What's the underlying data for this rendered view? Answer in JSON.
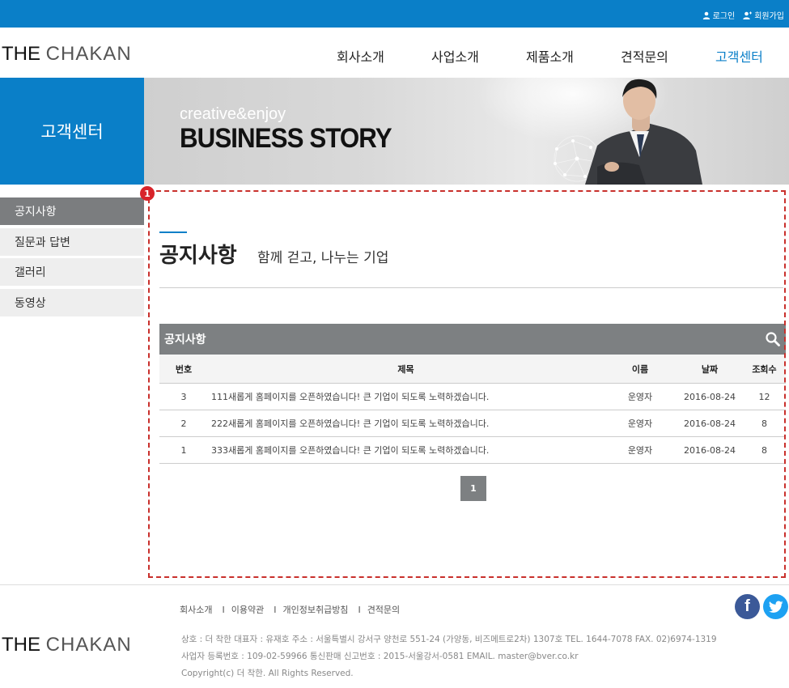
{
  "colors": {
    "brand": "#0a7fc8",
    "gray_bar": "#7d8082",
    "dash": "#c9302c",
    "marker": "#d8232a"
  },
  "top": {
    "login": "로그인",
    "join": "회원가입"
  },
  "logo": {
    "part1": "THE",
    "part2": "CHAKAN"
  },
  "nav": [
    {
      "label": "회사소개"
    },
    {
      "label": "사업소개"
    },
    {
      "label": "제품소개"
    },
    {
      "label": "견적문의"
    },
    {
      "label": "고객센터"
    }
  ],
  "section_title": "고객센터",
  "banner": {
    "sub": "creative&enjoy",
    "main": "BUSINESS STORY"
  },
  "sidebar": [
    {
      "label": "공지사항"
    },
    {
      "label": "질문과 답변"
    },
    {
      "label": "갤러리"
    },
    {
      "label": "동영상"
    }
  ],
  "marker": "1",
  "content": {
    "title": "공지사항",
    "subtitle": "함께 걷고, 나누는 기업"
  },
  "board": {
    "title": "공지사항",
    "headers": {
      "no": "번호",
      "title": "제목",
      "name": "이름",
      "date": "날짜",
      "views": "조회수"
    },
    "rows": [
      {
        "no": "3",
        "title": "111새롭게 홈페이지를 오픈하였습니다! 큰 기업이 되도록 노력하겠습니다.",
        "name": "운영자",
        "date": "2016-08-24",
        "views": "12"
      },
      {
        "no": "2",
        "title": "222새롭게 홈페이지를 오픈하였습니다! 큰 기업이 되도록 노력하겠습니다.",
        "name": "운영자",
        "date": "2016-08-24",
        "views": "8"
      },
      {
        "no": "1",
        "title": "333새롭게 홈페이지를 오픈하였습니다! 큰 기업이 되도록 노력하겠습니다.",
        "name": "운영자",
        "date": "2016-08-24",
        "views": "8"
      }
    ],
    "page": "1"
  },
  "footer": {
    "links": [
      {
        "label": "회사소개"
      },
      {
        "label": "이용약관"
      },
      {
        "label": "개인정보취급방침"
      },
      {
        "label": "견적문의"
      }
    ],
    "separator": "I",
    "info1": "상호 : 더 착한  대표자 : 유재호   주소 : 서울특별시 강서구 양천로 551-24 (가양동, 비즈메트로2차) 1307호   TEL. 1644-7078   FAX. 02)6974-1319",
    "info2": "사업자 등록번호 : 109-02-59966   통신판매 신고번호 : 2015-서울강서-0581   EMAIL. master@bver.co.kr",
    "copyright": "Copyright(c) 더 착한. All Rights Reserved.",
    "social": [
      {
        "icon": "facebook-icon",
        "glyph": "f"
      },
      {
        "icon": "twitter-icon"
      }
    ]
  }
}
